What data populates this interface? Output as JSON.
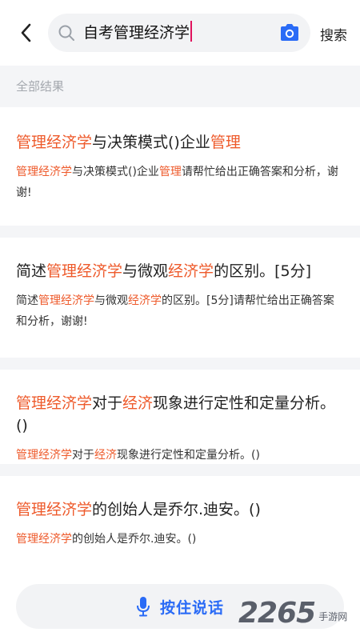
{
  "search": {
    "query": "自考管理经济学",
    "submit_label": "搜索"
  },
  "section": {
    "title": "全部结果"
  },
  "results": [
    {
      "title": [
        {
          "text": "管理经济学",
          "hl": true
        },
        {
          "text": "与决策模式()企业",
          "hl": false
        },
        {
          "text": "管理",
          "hl": true
        }
      ],
      "desc": [
        {
          "text": "管理经济学",
          "hl": true
        },
        {
          "text": "与决策模式()企业",
          "hl": false
        },
        {
          "text": "管理",
          "hl": true
        },
        {
          "text": "请帮忙给出正确答案和分析，谢谢!",
          "hl": false
        }
      ]
    },
    {
      "title": [
        {
          "text": "简述",
          "hl": false
        },
        {
          "text": "管理经济学",
          "hl": true
        },
        {
          "text": "与微观",
          "hl": false
        },
        {
          "text": "经济学",
          "hl": true
        },
        {
          "text": "的区别。[5分]",
          "hl": false
        }
      ],
      "desc": [
        {
          "text": "简述",
          "hl": false
        },
        {
          "text": "管理经济学",
          "hl": true
        },
        {
          "text": "与微观",
          "hl": false
        },
        {
          "text": "经济学",
          "hl": true
        },
        {
          "text": "的区别。[5分]请帮忙给出正确答案和分析，谢谢!",
          "hl": false
        }
      ]
    },
    {
      "title": [
        {
          "text": "管理经济学",
          "hl": true
        },
        {
          "text": "对于",
          "hl": false
        },
        {
          "text": "经济",
          "hl": true
        },
        {
          "text": "现象进行定性和定量分析。()",
          "hl": false
        }
      ],
      "desc": [
        {
          "text": "管理经济学",
          "hl": true
        },
        {
          "text": "对于",
          "hl": false
        },
        {
          "text": "经济",
          "hl": true
        },
        {
          "text": "现象进行定性和定量分析。()",
          "hl": false
        }
      ]
    },
    {
      "title": [
        {
          "text": "管理经济学",
          "hl": true
        },
        {
          "text": "的创始人是乔尔.迪安。()",
          "hl": false
        }
      ],
      "desc": [
        {
          "text": "管理经济学",
          "hl": true
        },
        {
          "text": "的创始人是乔尔.迪安。()",
          "hl": false
        }
      ]
    }
  ],
  "voice": {
    "label": "按住说话"
  },
  "watermark": {
    "number": "2265",
    "site": "手游网"
  },
  "icons": {
    "back": "back-arrow-icon",
    "search": "search-icon",
    "camera": "camera-icon",
    "mic": "mic-icon"
  },
  "colors": {
    "highlight": "#ee5a2b",
    "accent": "#2a6bf6",
    "cursor": "#e0125c"
  }
}
